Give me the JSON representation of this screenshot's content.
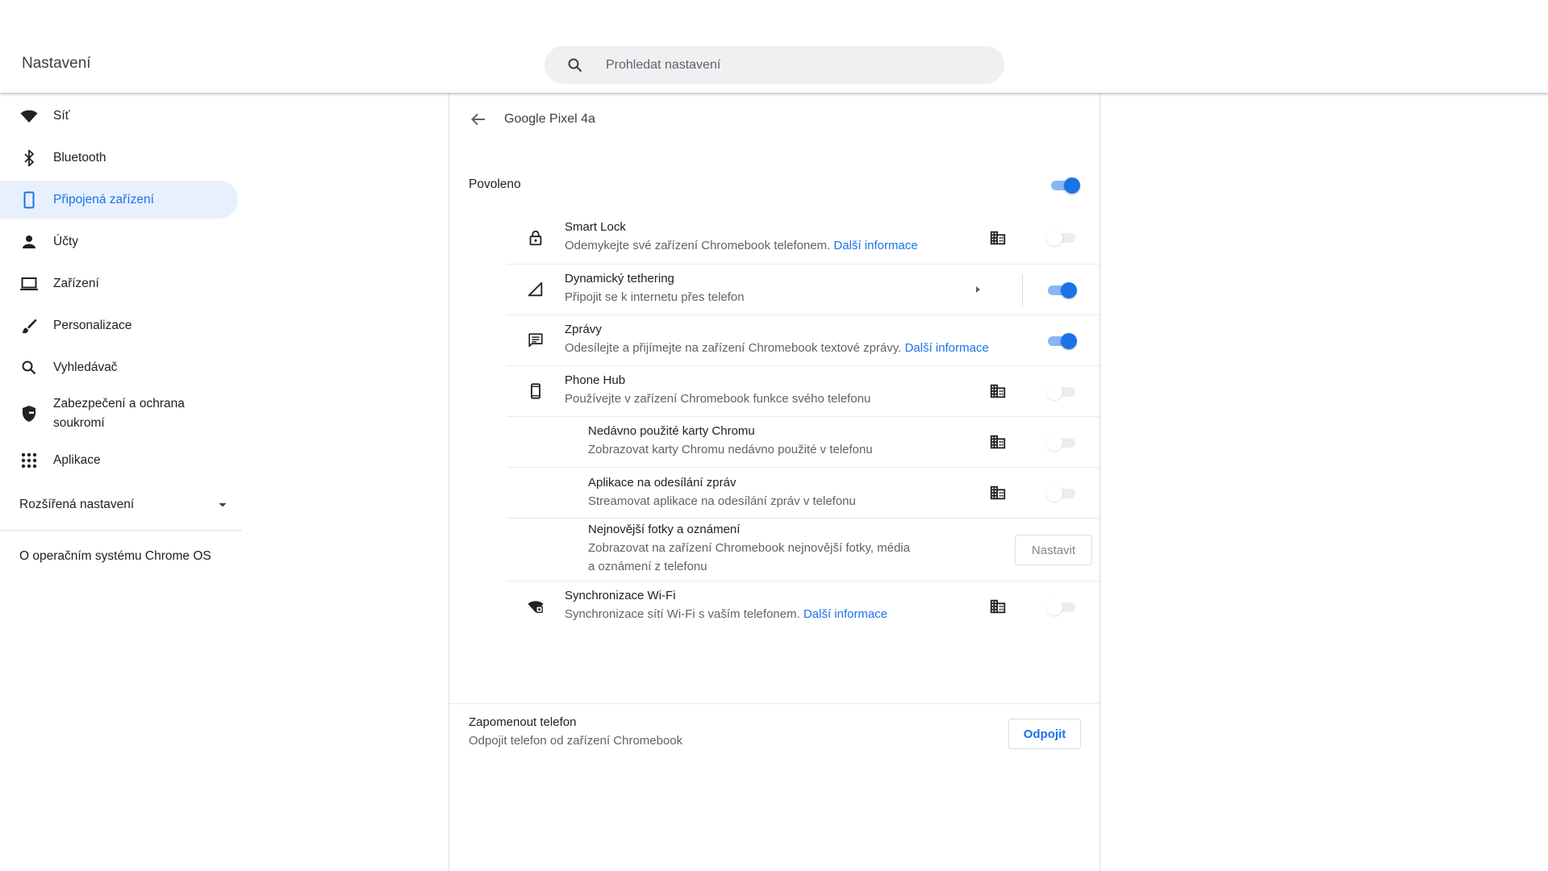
{
  "window": {
    "minimize": "minimize-icon",
    "restore": "restore-icon",
    "close": "close-icon"
  },
  "header": {
    "title": "Nastavení",
    "search_placeholder": "Prohledat nastavení"
  },
  "sidebar": {
    "items": [
      {
        "label": "Síť",
        "icon": "wifi-icon"
      },
      {
        "label": "Bluetooth",
        "icon": "bluetooth-icon"
      },
      {
        "label": "Připojená zařízení",
        "icon": "phone-icon",
        "active": true
      },
      {
        "label": "Účty",
        "icon": "person-icon"
      },
      {
        "label": "Zařízení",
        "icon": "laptop-icon"
      },
      {
        "label": "Personalizace",
        "icon": "brush-icon"
      },
      {
        "label": "Vyhledávač",
        "icon": "search-icon"
      },
      {
        "label": "Zabezpečení a ochrana soukromí",
        "icon": "shield-icon"
      },
      {
        "label": "Aplikace",
        "icon": "apps-grid-icon"
      }
    ],
    "advanced": "Rozšířená nastavení",
    "about": "O operačním systému Chrome OS"
  },
  "main": {
    "title": "Google Pixel 4a",
    "enabled_label": "Povoleno",
    "enabled_on": true,
    "features": {
      "smart_lock": {
        "title": "Smart Lock",
        "sub": "Odemykejte své zařízení Chromebook telefonem.",
        "link": "Další informace",
        "on": false
      },
      "tethering": {
        "title": "Dynamický tethering",
        "sub": "Připojit se k internetu přes telefon",
        "on": true
      },
      "messages": {
        "title": "Zprávy",
        "sub": "Odesílejte a přijímejte na zařízení Chromebook textové zprávy.",
        "link": "Další informace",
        "on": true
      },
      "phone_hub": {
        "title": "Phone Hub",
        "sub": "Používejte v zařízení Chromebook funkce svého telefonu",
        "on": false
      },
      "chrome_tabs": {
        "title": "Nedávno použité karty Chromu",
        "sub": "Zobrazovat karty Chromu nedávno použité v telefonu",
        "on": false
      },
      "message_apps": {
        "title": "Aplikace na odesílání zpráv",
        "sub": "Streamovat aplikace na odesílání zpráv v telefonu",
        "on": false
      },
      "photos": {
        "title": "Nejnovější fotky a oznámení",
        "sub1": "Zobrazovat na zařízení Chromebook nejnovější fotky, média",
        "sub2": "a oznámení z telefonu",
        "button": "Nastavit"
      },
      "wifi_sync": {
        "title": "Synchronizace Wi-Fi",
        "sub": "Synchronizace sítí Wi-Fi s vaším telefonem.",
        "link": "Další informace",
        "on": false
      }
    },
    "forget": {
      "title": "Zapomenout telefon",
      "sub": "Odpojit telefon od zařízení Chromebook",
      "button": "Odpojit"
    }
  },
  "colors": {
    "accent": "#1a73e8",
    "active_bg": "#e8f0fe",
    "secondary_text": "#5f6368"
  }
}
